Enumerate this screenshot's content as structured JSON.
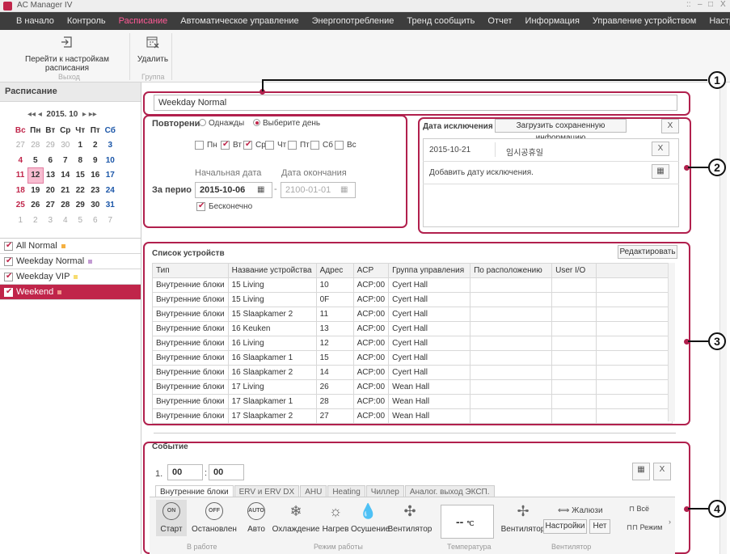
{
  "window": {
    "title": "AC Manager IV",
    "controls": [
      "::",
      "–",
      "□",
      "X"
    ]
  },
  "menu": {
    "items": [
      {
        "label": "В начало",
        "active": false
      },
      {
        "label": "Контроль",
        "active": false
      },
      {
        "label": "Расписание",
        "active": true
      },
      {
        "label": "Автоматическое управление",
        "active": false
      },
      {
        "label": "Энергопотребление",
        "active": false
      },
      {
        "label": "Тренд сообщить",
        "active": false
      },
      {
        "label": "Отчет",
        "active": false
      },
      {
        "label": "Информация",
        "active": false
      },
      {
        "label": "Управление устройством",
        "active": false
      },
      {
        "label": "Настройки",
        "active": false
      }
    ]
  },
  "ribbon": {
    "goto_label": "Перейти к настройкам расписания",
    "delete_label": "Удалить",
    "group_exit": "Выход",
    "group_group": "Группа"
  },
  "sidebar": {
    "title": "Расписание",
    "calendar": {
      "nav_left": "◂◂  ◂",
      "year": "2015.",
      "month": "10",
      "nav_right": "▸  ▸▸",
      "weekdays": [
        "Вс",
        "Пн",
        "Вт",
        "Ср",
        "Чт",
        "Пт",
        "Сб"
      ],
      "weeks": [
        [
          "27",
          "28",
          "29",
          "30",
          "1",
          "2",
          "3"
        ],
        [
          "4",
          "5",
          "6",
          "7",
          "8",
          "9",
          "10"
        ],
        [
          "11",
          "12",
          "13",
          "14",
          "15",
          "16",
          "17"
        ],
        [
          "18",
          "19",
          "20",
          "21",
          "22",
          "23",
          "24"
        ],
        [
          "25",
          "26",
          "27",
          "28",
          "29",
          "30",
          "31"
        ],
        [
          "1",
          "2",
          "3",
          "4",
          "5",
          "6",
          "7"
        ]
      ],
      "selected": "12"
    },
    "schedules": [
      {
        "label": "All Normal",
        "color": "#f5b041",
        "selected": false
      },
      {
        "label": "Weekday Normal",
        "color": "#c39bd3",
        "selected": false
      },
      {
        "label": "Weekday VIP",
        "color": "#f7dc6f",
        "selected": false
      },
      {
        "label": "Weekend",
        "color": "#f1948a",
        "selected": true
      }
    ]
  },
  "schedule": {
    "name": "Weekday Normal",
    "repeat_label": "Повторени",
    "once_label": "Однажды",
    "choose_day_label": "Выберите день",
    "days": [
      {
        "label": "Пн",
        "on": false
      },
      {
        "label": "Вт",
        "on": true
      },
      {
        "label": "Ср",
        "on": true
      },
      {
        "label": "Чт",
        "on": false
      },
      {
        "label": "Пт",
        "on": false
      },
      {
        "label": "Сб",
        "on": false
      },
      {
        "label": "Вс",
        "on": false
      }
    ],
    "period_label": "За перио",
    "start_label": "Начальная дата",
    "end_label": "Дата окончания",
    "start_date": "2015-10-06",
    "end_date": "2100-01-01",
    "infinite_label": "Бесконечно"
  },
  "exceptions": {
    "title": "Дата исключения",
    "load_label": "Загрузить сохраненную информацию",
    "close": "X",
    "rows": [
      {
        "date": "2015-10-21",
        "name": "임시공휴일",
        "remove": "X"
      }
    ],
    "add_label": "Добавить дату исключения."
  },
  "devices": {
    "title": "Список устройств",
    "edit_label": "Редактировать",
    "columns": [
      "Тип",
      "Название устройства",
      "Адрес",
      "ACP",
      "Группа управления",
      "По расположению",
      "User I/O",
      ""
    ],
    "rows": [
      [
        "Внутренние блоки",
        "15 Living",
        "10",
        "ACP:00",
        "Cyert Hall",
        "",
        "",
        ""
      ],
      [
        "Внутренние блоки",
        "15 Living",
        "0F",
        "ACP:00",
        "Cyert Hall",
        "",
        "",
        ""
      ],
      [
        "Внутренние блоки",
        "15 Slaapkamer 2",
        "11",
        "ACP:00",
        "Cyert Hall",
        "",
        "",
        ""
      ],
      [
        "Внутренние блоки",
        "16 Keuken",
        "13",
        "ACP:00",
        "Cyert Hall",
        "",
        "",
        ""
      ],
      [
        "Внутренние блоки",
        "16 Living",
        "12",
        "ACP:00",
        "Cyert Hall",
        "",
        "",
        ""
      ],
      [
        "Внутренние блоки",
        "16 Slaapkamer 1",
        "15",
        "ACP:00",
        "Cyert Hall",
        "",
        "",
        ""
      ],
      [
        "Внутренние блоки",
        "16 Slaapkamer 2",
        "14",
        "ACP:00",
        "Cyert Hall",
        "",
        "",
        ""
      ],
      [
        "Внутренние блоки",
        "17 Living",
        "26",
        "ACP:00",
        "Wean Hall",
        "",
        "",
        ""
      ],
      [
        "Внутренние блоки",
        "17 Slaapkamer 1",
        "28",
        "ACP:00",
        "Wean Hall",
        "",
        "",
        ""
      ],
      [
        "Внутренние блоки",
        "17 Slaapkamer 2",
        "27",
        "ACP:00",
        "Wean Hall",
        "",
        "",
        ""
      ]
    ]
  },
  "event": {
    "title": "Событие",
    "index": "1.",
    "hour": "00",
    "minute": "00",
    "close": "X",
    "tabs": [
      {
        "label": "Внутренние блоки",
        "on": true
      },
      {
        "label": "ERV и ERV DX",
        "on": false
      },
      {
        "label": "AHU",
        "on": false
      },
      {
        "label": "Heating",
        "on": false
      },
      {
        "label": "Чиллер",
        "on": false
      },
      {
        "label": "Аналог. выход ЭКСП.",
        "on": false
      }
    ],
    "operation": {
      "on_icon": "ON",
      "off_icon": "OFF",
      "start": "Старт",
      "stop": "Остановлен",
      "group": "В работе"
    },
    "modes": {
      "auto_icon": "AUTO",
      "auto": "Авто",
      "cool": "Охлаждение",
      "heat": "Нагрев",
      "dry": "Осушение",
      "fan": "Вентилятор",
      "group": "Режим работы"
    },
    "temp": {
      "value": "--",
      "unit": "℃",
      "group": "Температура"
    },
    "fan": {
      "fan": "Вентилятор",
      "louver": "Жалюзи",
      "settings": "Настройки",
      "none": "Нет",
      "group": "Вентилятор"
    },
    "extra": {
      "all": "Всё",
      "mode": "Режим"
    }
  },
  "callouts": [
    "1",
    "2",
    "3",
    "4"
  ],
  "colors": {
    "accent": "#c0254a",
    "frame": "#b1204d",
    "menubar": "#3d3d3d"
  }
}
